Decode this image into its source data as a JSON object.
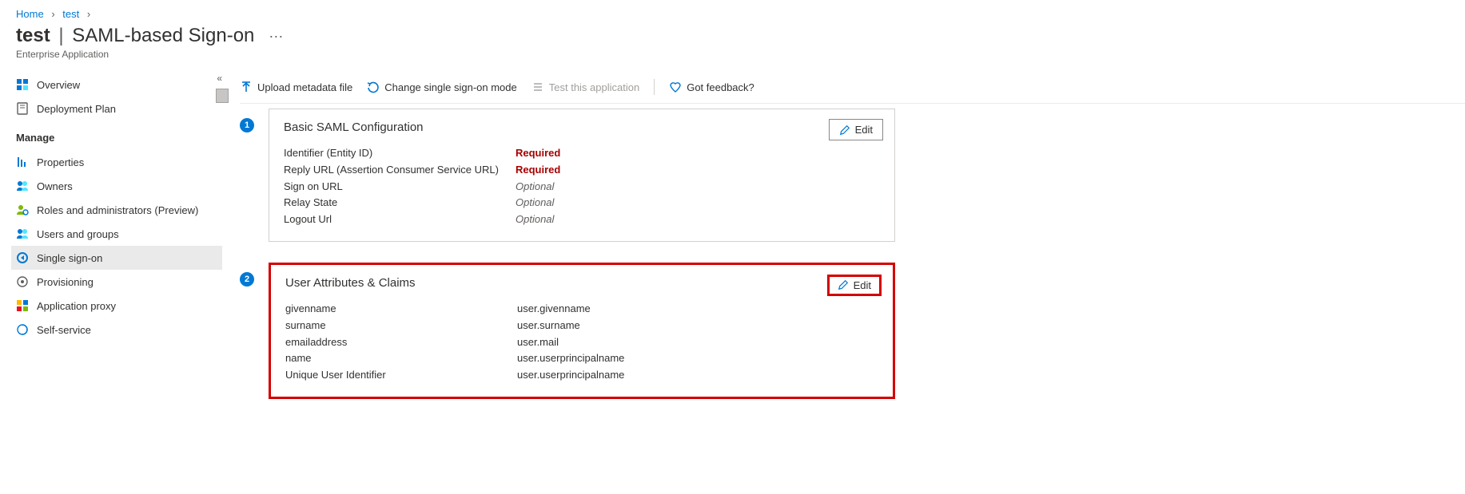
{
  "breadcrumb": {
    "home": "Home",
    "test": "test"
  },
  "header": {
    "bold": "test",
    "title": "SAML-based Sign-on",
    "sub": "Enterprise Application"
  },
  "sidebar": {
    "overview": "Overview",
    "deployment": "Deployment Plan",
    "manage_label": "Manage",
    "properties": "Properties",
    "owners": "Owners",
    "roles": "Roles and administrators (Preview)",
    "users": "Users and groups",
    "sso": "Single sign-on",
    "provisioning": "Provisioning",
    "appproxy": "Application proxy",
    "selfservice": "Self-service"
  },
  "toolbar": {
    "upload": "Upload metadata file",
    "change": "Change single sign-on mode",
    "test": "Test this application",
    "feedback": "Got feedback?"
  },
  "step1": {
    "num": "1",
    "title": "Basic SAML Configuration",
    "edit": "Edit",
    "rows": {
      "identifier_k": "Identifier (Entity ID)",
      "identifier_v": "Required",
      "reply_k": "Reply URL (Assertion Consumer Service URL)",
      "reply_v": "Required",
      "signon_k": "Sign on URL",
      "signon_v": "Optional",
      "relay_k": "Relay State",
      "relay_v": "Optional",
      "logout_k": "Logout Url",
      "logout_v": "Optional"
    }
  },
  "step2": {
    "num": "2",
    "title": "User Attributes & Claims",
    "edit": "Edit",
    "rows": {
      "given_k": "givenname",
      "given_v": "user.givenname",
      "surname_k": "surname",
      "surname_v": "user.surname",
      "email_k": "emailaddress",
      "email_v": "user.mail",
      "name_k": "name",
      "name_v": "user.userprincipalname",
      "uid_k": "Unique User Identifier",
      "uid_v": "user.userprincipalname"
    }
  }
}
